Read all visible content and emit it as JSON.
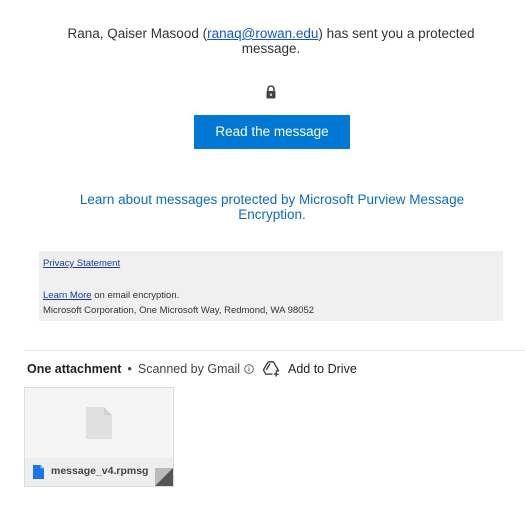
{
  "message": {
    "sender_name": "Rana, Qaiser Masood",
    "sender_open_paren": " (",
    "sender_email": "ranaq@rowan.edu",
    "sender_suffix": ") has sent you a protected message.",
    "read_button_label": "Read the message",
    "learn_link": "Learn about messages protected by Microsoft Purview Message Encryption."
  },
  "footer": {
    "privacy_statement": "Privacy Statement",
    "learn_more": "Learn More",
    "learn_more_suffix": " on email encryption.",
    "address": "Microsoft Corporation, One Microsoft Way, Redmond, WA 98052"
  },
  "attachments": {
    "count_label": "One attachment",
    "separator": "•",
    "scanned_label": "Scanned by Gmail",
    "add_to_drive": "Add to Drive",
    "files": [
      {
        "name": "message_v4.rpmsg"
      }
    ]
  },
  "colors": {
    "accent": "#0078d4",
    "link": "#0b6cbd",
    "footer_bg": "#f0f0f0",
    "file_icon": "#1a73e8"
  },
  "icons": {
    "lock": "lock-icon",
    "info": "info-icon",
    "drive": "add-to-drive-icon",
    "document": "document-icon"
  }
}
